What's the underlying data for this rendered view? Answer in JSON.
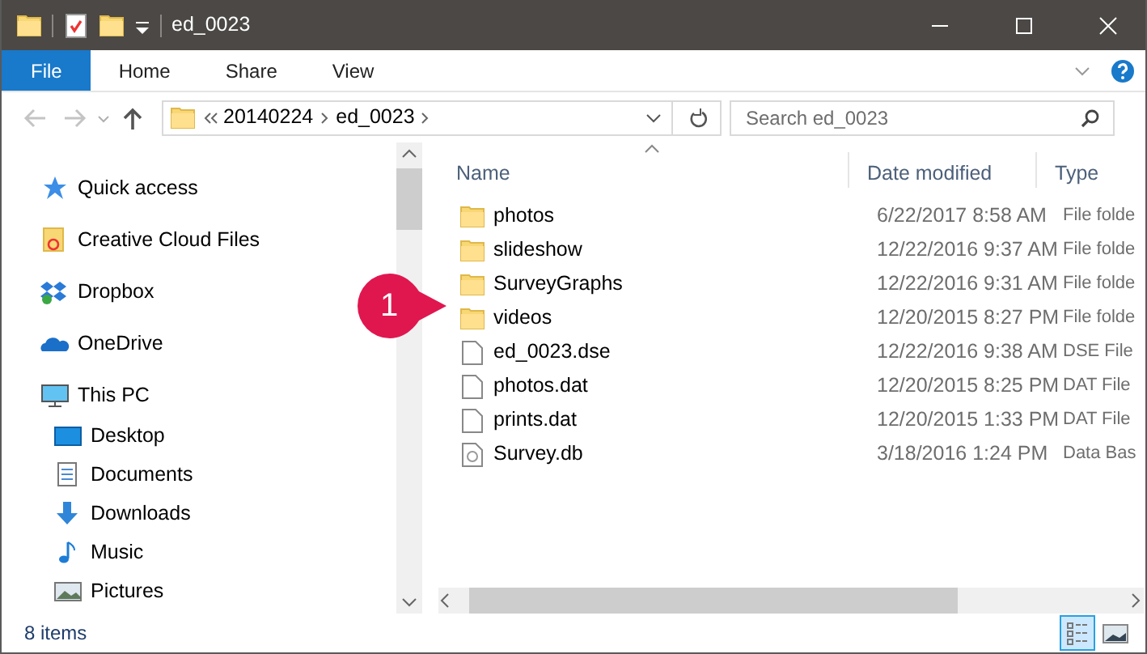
{
  "window": {
    "title": "ed_0023"
  },
  "ribbon": {
    "tabs": [
      {
        "label": "File",
        "selected": true
      },
      {
        "label": "Home",
        "selected": false
      },
      {
        "label": "Share",
        "selected": false
      },
      {
        "label": "View",
        "selected": false
      }
    ]
  },
  "navigation": {
    "back": {
      "disabled": true
    },
    "forward": {
      "disabled": true
    },
    "up": {
      "disabled": false
    }
  },
  "address": {
    "breadcrumbs": [
      "20140224",
      "ed_0023"
    ]
  },
  "search": {
    "placeholder": "Search ed_0023"
  },
  "sidebar": {
    "items": [
      {
        "label": "Quick access",
        "selected": false
      },
      {
        "label": "Creative Cloud Files",
        "selected": false
      },
      {
        "label": "Dropbox",
        "selected": false
      },
      {
        "label": "OneDrive",
        "selected": false
      },
      {
        "label": "This PC",
        "selected": false,
        "children": [
          {
            "label": "Desktop",
            "selected": false
          },
          {
            "label": "Documents",
            "selected": false
          },
          {
            "label": "Downloads",
            "selected": false
          },
          {
            "label": "Music",
            "selected": false
          },
          {
            "label": "Pictures",
            "selected": false
          }
        ]
      }
    ]
  },
  "file_list": {
    "columns": [
      {
        "label": "Name",
        "sorted": true
      },
      {
        "label": "Date modified",
        "sorted": false
      },
      {
        "label": "Type",
        "sorted": false
      }
    ],
    "rows": [
      {
        "kind": "folder",
        "name": "photos",
        "date": "6/22/2017 8:58 AM",
        "type": "File folde"
      },
      {
        "kind": "folder",
        "name": "slideshow",
        "date": "12/22/2016 9:37 AM",
        "type": "File folde"
      },
      {
        "kind": "folder",
        "name": "SurveyGraphs",
        "date": "12/22/2016 9:31 AM",
        "type": "File folde"
      },
      {
        "kind": "folder",
        "name": "videos",
        "date": "12/20/2015 8:27 PM",
        "type": "File folde"
      },
      {
        "kind": "file",
        "name": "ed_0023.dse",
        "date": "12/22/2016 9:38 AM",
        "type": "DSE File"
      },
      {
        "kind": "file",
        "name": "photos.dat",
        "date": "12/20/2015 8:25 PM",
        "type": "DAT File"
      },
      {
        "kind": "file",
        "name": "prints.dat",
        "date": "12/20/2015 1:33 PM",
        "type": "DAT File"
      },
      {
        "kind": "database",
        "name": "Survey.db",
        "date": "3/18/2016 1:24 PM",
        "type": "Data Bas"
      }
    ]
  },
  "callout": {
    "label": "1"
  },
  "status_bar": {
    "text": "8 items",
    "views": [
      {
        "kind": "details",
        "selected": true
      },
      {
        "kind": "large-icons",
        "selected": false
      }
    ]
  }
}
